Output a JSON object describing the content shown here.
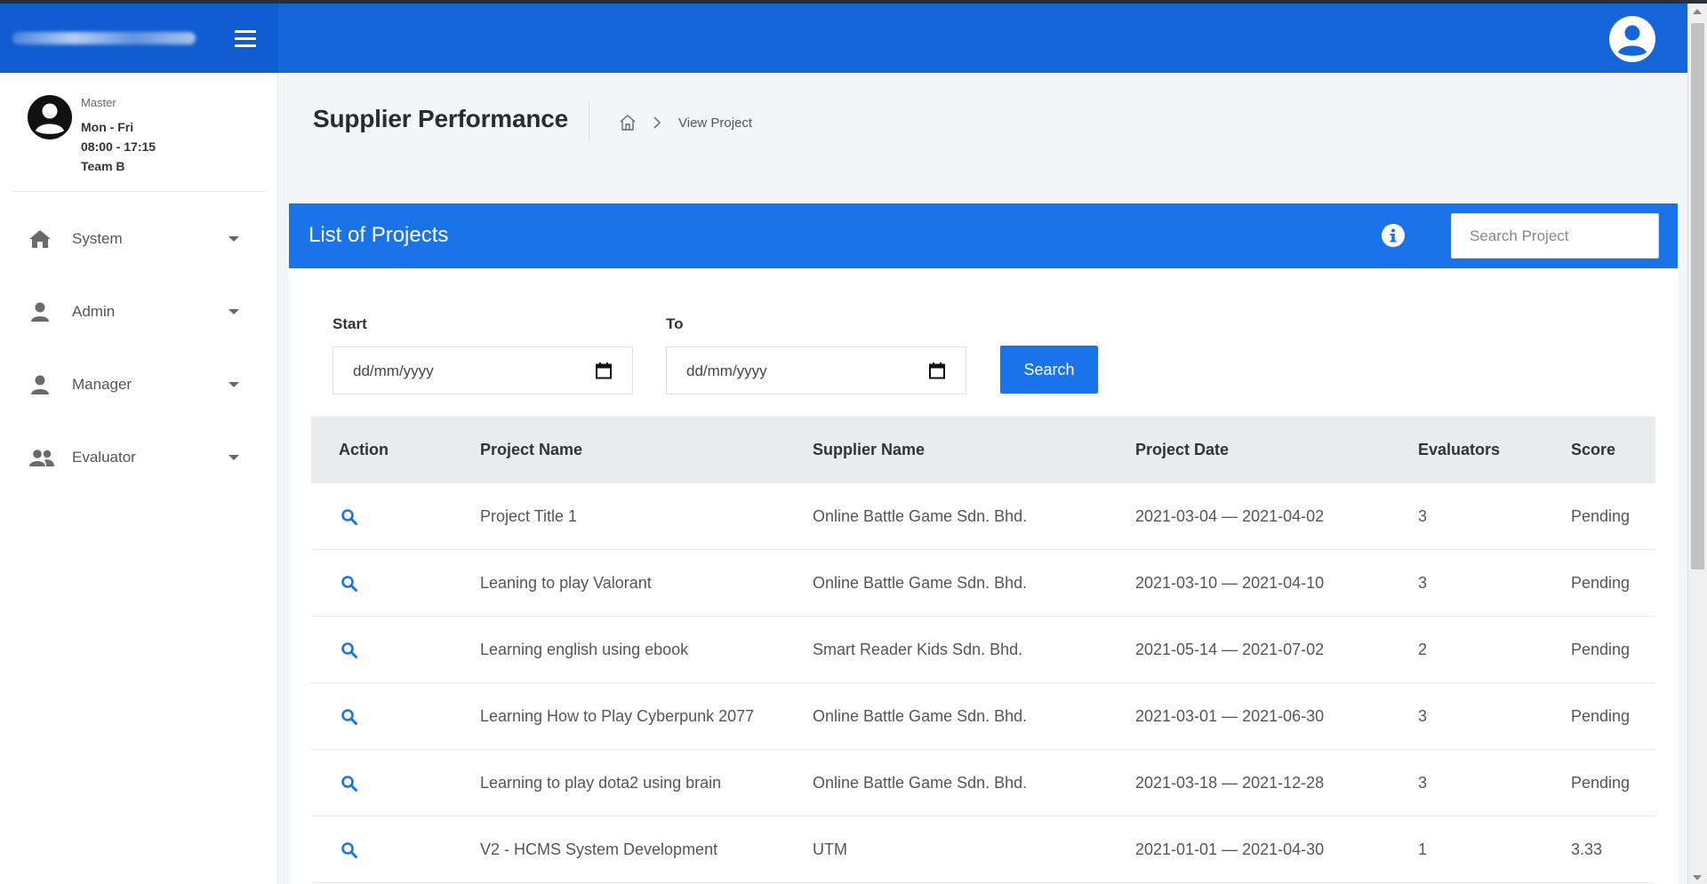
{
  "sidebar": {
    "profile": {
      "role": "Master",
      "days": "Mon - Fri",
      "hours": "08:00 - 17:15",
      "team": "Team B"
    },
    "items": [
      {
        "label": "System",
        "icon": "home-icon"
      },
      {
        "label": "Admin",
        "icon": "user-icon"
      },
      {
        "label": "Manager",
        "icon": "user-icon"
      },
      {
        "label": "Evaluator",
        "icon": "users-icon"
      }
    ]
  },
  "header": {
    "page_title": "Supplier Performance",
    "breadcrumb_current": "View Project"
  },
  "panel": {
    "title": "List of Projects",
    "search_placeholder": "Search Project",
    "start_label": "Start",
    "to_label": "To",
    "start_value": "dd/mm/yyyy",
    "to_value": "dd/mm/yyyy",
    "search_button": "Search"
  },
  "table": {
    "columns": [
      "Action",
      "Project Name",
      "Supplier Name",
      "Project Date",
      "Evaluators",
      "Score"
    ],
    "rows": [
      {
        "project": "Project Title 1",
        "supplier": "Online Battle Game Sdn. Bhd.",
        "date": "2021-03-04 — 2021-04-02",
        "evaluators": "3",
        "score": "Pending"
      },
      {
        "project": "Leaning to play Valorant",
        "supplier": "Online Battle Game Sdn. Bhd.",
        "date": "2021-03-10 — 2021-04-10",
        "evaluators": "3",
        "score": "Pending"
      },
      {
        "project": "Learning english using ebook",
        "supplier": "Smart Reader Kids Sdn. Bhd.",
        "date": "2021-05-14 — 2021-07-02",
        "evaluators": "2",
        "score": "Pending"
      },
      {
        "project": "Learning How to Play Cyberpunk 2077",
        "supplier": "Online Battle Game Sdn. Bhd.",
        "date": "2021-03-01 — 2021-06-30",
        "evaluators": "3",
        "score": "Pending"
      },
      {
        "project": "Learning to play dota2 using brain",
        "supplier": "Online Battle Game Sdn. Bhd.",
        "date": "2021-03-18 — 2021-12-28",
        "evaluators": "3",
        "score": "Pending"
      },
      {
        "project": "V2 - HCMS System Development",
        "supplier": "UTM",
        "date": "2021-01-01 — 2021-04-30",
        "evaluators": "1",
        "score": "3.33"
      }
    ]
  },
  "colors": {
    "navbar": "#1565d8",
    "brand": "#0f5bd0",
    "panel_header": "#1a73e8",
    "table_header": "#e9ebef"
  }
}
